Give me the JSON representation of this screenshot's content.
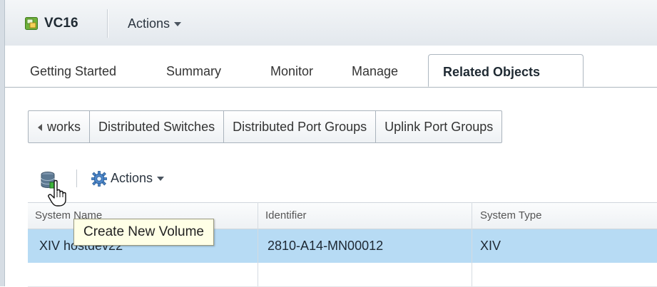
{
  "header": {
    "object_name": "VC16",
    "actions_label": "Actions"
  },
  "tabs": [
    {
      "label": "Getting Started",
      "active": false
    },
    {
      "label": "Summary",
      "active": false
    },
    {
      "label": "Monitor",
      "active": false
    },
    {
      "label": "Manage",
      "active": false
    },
    {
      "label": "Related Objects",
      "active": true
    }
  ],
  "related_tabs": {
    "back_label": "works",
    "items": [
      "Distributed Switches",
      "Distributed Port Groups",
      "Uplink Port Groups"
    ]
  },
  "toolbar": {
    "create_volume_icon": "storage-volume-icon",
    "actions_label": "Actions",
    "actions_icon": "gear-icon"
  },
  "table": {
    "columns": [
      "System Name",
      "Identifier",
      "System Type"
    ],
    "rows": [
      {
        "system_name": "XIV hostdev22",
        "identifier": "2810-A14-MN00012",
        "system_type": "XIV",
        "selected": true
      }
    ]
  },
  "tooltip": {
    "text": "Create New Volume"
  },
  "colors": {
    "selected_row": "#b7dbf4",
    "tooltip_bg": "#ffffe6"
  }
}
